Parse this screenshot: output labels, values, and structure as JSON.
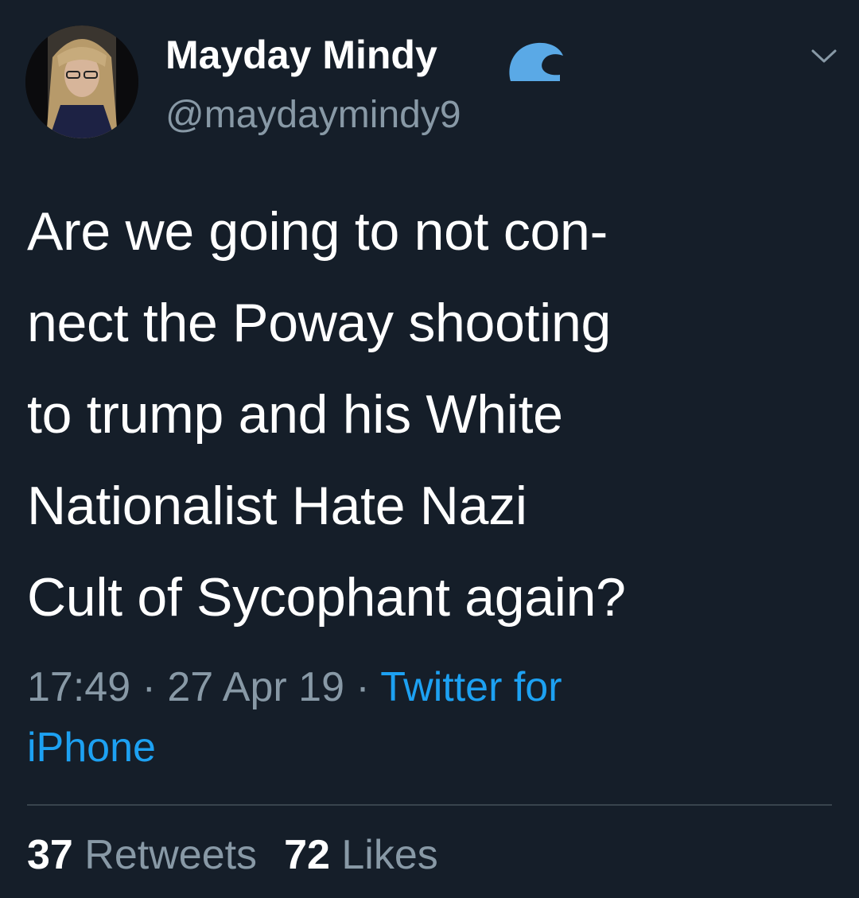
{
  "tweet": {
    "author": {
      "display_name": "Mayday Mindy",
      "handle": "@maydaymindy9",
      "badge_icon": "wave-icon",
      "avatar": "avatar"
    },
    "text": "Are we going to not con-\nnect the Poway shooting\nto trump and his White\nNationalist Hate Nazi\nCult of Sycophant again?",
    "time": "17:49",
    "separator": " · ",
    "date": "27 Apr 19",
    "source_line1": "Twitter for",
    "source_line2": "iPhone",
    "retweets_count": "37",
    "retweets_label": "Retweets",
    "likes_count": "72",
    "likes_label": "Likes"
  },
  "colors": {
    "background": "#151e29",
    "text": "#ffffff",
    "secondary": "#8899a6",
    "link": "#1da1f2",
    "divider": "#38444d"
  }
}
